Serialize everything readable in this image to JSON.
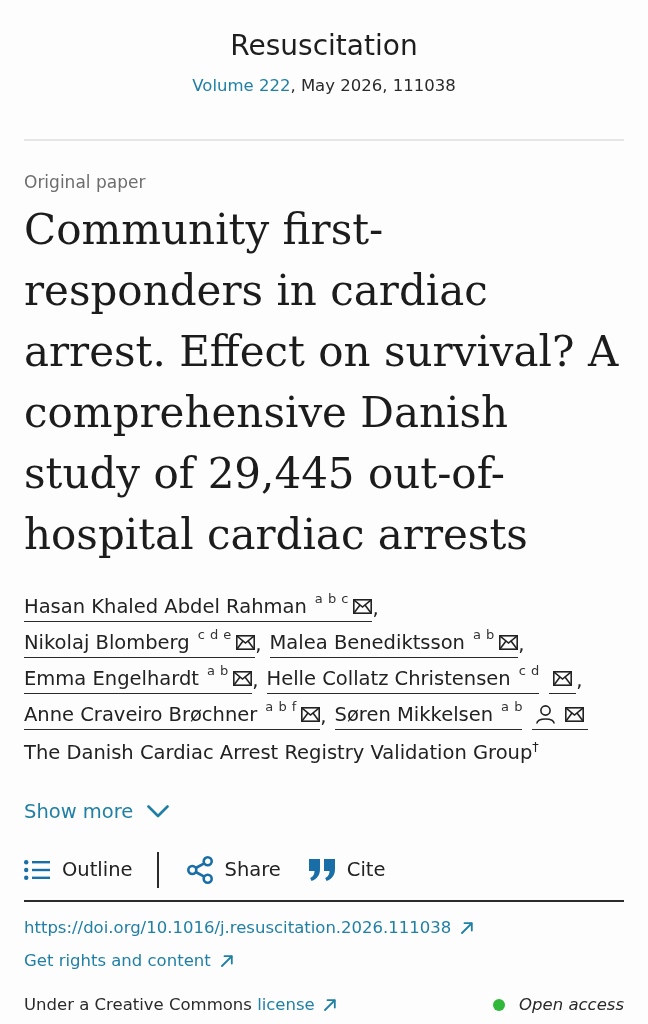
{
  "journal": {
    "title": "Resuscitation",
    "volume": "Volume 222",
    "details": ", May 2026, 111038"
  },
  "article": {
    "type": "Original paper",
    "title": "Community first-responders in cardiac arrest. Effect on survival? A comprehensive Danish study of 29,445 out-of-hospital cardiac arrests"
  },
  "authors": [
    {
      "name": "Hasan Khaled Abdel Rahman",
      "affiliations": "a b c",
      "profile": false,
      "icons_apart": false,
      "separator": ","
    },
    {
      "name": "Nikolaj Blomberg",
      "affiliations": "c d e",
      "profile": false,
      "icons_apart": false,
      "separator": ","
    },
    {
      "name": "Malea Benediktsson",
      "affiliations": "a b",
      "profile": false,
      "icons_apart": false,
      "separator": ","
    },
    {
      "name": "Emma Engelhardt",
      "affiliations": "a b",
      "profile": false,
      "icons_apart": false,
      "separator": ","
    },
    {
      "name": "Helle Collatz Christensen",
      "affiliations": "c d",
      "profile": false,
      "icons_apart": true,
      "separator": ","
    },
    {
      "name": "Anne Craveiro Brøchner",
      "affiliations": "a b f",
      "profile": false,
      "icons_apart": false,
      "separator": ","
    },
    {
      "name": "Søren Mikkelsen",
      "affiliations": "a b",
      "profile": true,
      "icons_apart": true
    }
  ],
  "group": "The Danish Cardiac Arrest Registry Validation Group$^{†}$",
  "show_more": {
    "label": "Show more",
    "expanded": false
  },
  "toolbar": [
    {
      "kind": "outline",
      "label": "Outline"
    },
    {
      "kind": "share",
      "label": "Share"
    },
    {
      "kind": "cite",
      "label": "Cite"
    }
  ],
  "links": [
    {
      "label": "https://doi.org/10.1016/j.resuscitation.2026.111038"
    },
    {
      "label": "Get rights and content"
    }
  ],
  "license": {
    "text": "Under a Creative Commons",
    "link": "license",
    "access": "Open access"
  }
}
